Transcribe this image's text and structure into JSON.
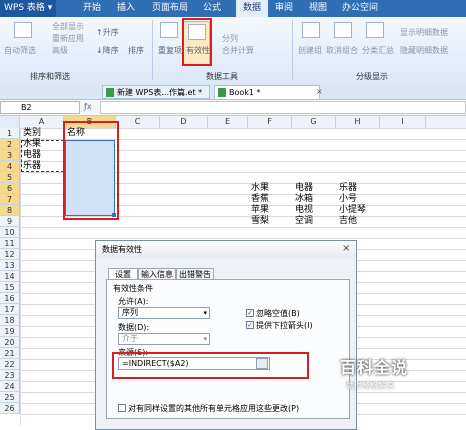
{
  "app": {
    "name": "WPS 表格"
  },
  "menu": [
    "开始",
    "插入",
    "页面布局",
    "公式",
    "数据",
    "审阅",
    "视图",
    "办公空间"
  ],
  "ribbon": {
    "buttons": {
      "auto_filter": "自动筛选",
      "show_all": "全部显示",
      "reapply": "重新应用",
      "advanced": "高级",
      "ascending": "升序",
      "descending": "降序",
      "sort": "排序",
      "highlight_duplicates": "重复项",
      "data_validation": "有效性",
      "text_to_columns": "分列",
      "merge_calc": "合并计算",
      "create_group": "创建组",
      "ungroup": "取消组合",
      "subtotal": "分类汇总",
      "show_detail": "显示明细数据",
      "hide_detail": "隐藏明细数据"
    },
    "groups": {
      "sort_filter": "排序和筛选",
      "data_tools": "数据工具",
      "outline": "分级显示"
    }
  },
  "doc_tabs": [
    "新建 WPS表...作篇.et *",
    "Book1 *"
  ],
  "namebox": "B2",
  "columns": [
    "A",
    "B",
    "C",
    "D",
    "E",
    "F",
    "G",
    "H",
    "I"
  ],
  "rows": [
    "1",
    "2",
    "3",
    "4",
    "5",
    "6",
    "7",
    "8",
    "9",
    "10",
    "11",
    "12",
    "13",
    "14",
    "15",
    "16",
    "17",
    "18",
    "19",
    "20",
    "21",
    "22",
    "23",
    "24",
    "25",
    "26"
  ],
  "cells": {
    "a1": "类别",
    "b1": "名称",
    "a2": "水果",
    "a3": "电器",
    "a4": "乐器",
    "f7": "水果",
    "g7": "电器",
    "h7": "乐器",
    "f8": "香蕉",
    "g8": "冰箱",
    "h8": "小号",
    "f9": "苹果",
    "g9": "电视",
    "h9": "小提琴",
    "f10": "雪梨",
    "g10": "空调",
    "h10": "吉他"
  },
  "dialog": {
    "title": "数据有效性",
    "tabs": [
      "设置",
      "输入信息",
      "出错警告"
    ],
    "section": "有效性条件",
    "allow_label": "允许(A):",
    "allow_value": "序列",
    "data_label": "数据(D):",
    "data_value": "介于",
    "ignore_blank": "忽略空值(B)",
    "in_cell_dropdown": "提供下拉箭头(I)",
    "source_label": "来源(S):",
    "source_value": "=INDIRECT($A2)",
    "apply_all": "对有同样设置的其他所有单元格应用这些更改(P)"
  },
  "watermark": {
    "title": "百科全说",
    "subtitle": "助你轻松解决"
  },
  "colors": {
    "accent_red": "#d81e1e",
    "title_bar": "#2f6db5",
    "selection": "#cfe2f7"
  }
}
